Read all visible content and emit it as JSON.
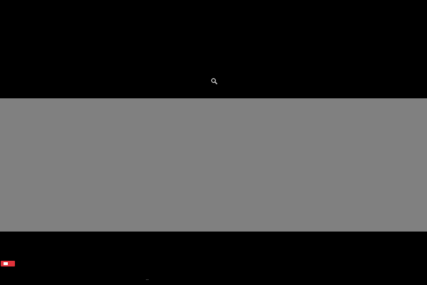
{
  "screen": {
    "background_color": "#000000",
    "band_color": "#808080"
  },
  "icons": {
    "cursor": "magnifier-cursor-icon",
    "indicator": "record-indicator-icon"
  },
  "indicator": {
    "color": "#e0323a"
  }
}
